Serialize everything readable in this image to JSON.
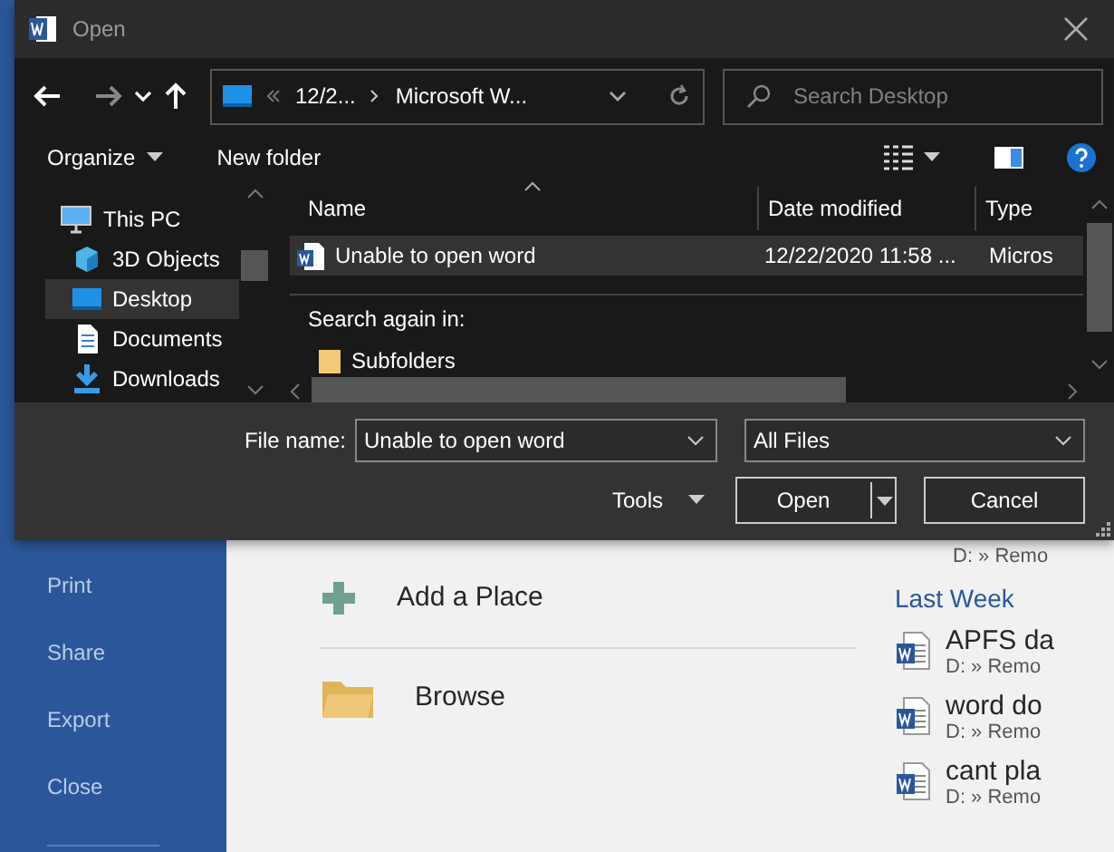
{
  "dialog": {
    "title": "Open",
    "address": {
      "segments": [
        "12/2...",
        "Microsoft W..."
      ]
    },
    "search": {
      "placeholder": "Search Desktop"
    },
    "toolbar": {
      "organize": "Organize",
      "new_folder": "New folder"
    },
    "nav_pane": [
      {
        "label": "This PC",
        "selected": false,
        "children": [
          {
            "label": "3D Objects",
            "selected": false,
            "kind": "cube"
          },
          {
            "label": "Desktop",
            "selected": true,
            "kind": "desktop"
          },
          {
            "label": "Documents",
            "selected": false,
            "kind": "document"
          },
          {
            "label": "Downloads",
            "selected": false,
            "kind": "download"
          }
        ]
      }
    ],
    "table": {
      "columns": [
        "Name",
        "Date modified",
        "Type"
      ],
      "rows": [
        {
          "name": "Unable to open word",
          "date": "12/22/2020 11:58 ...",
          "type": "Micros",
          "selected": true
        }
      ]
    },
    "search_again": {
      "label": "Search again in:",
      "items": [
        "Subfolders"
      ]
    },
    "file_name": {
      "label": "File name:",
      "value": "Unable to open word"
    },
    "file_type": {
      "value": "All Files"
    },
    "tools": "Tools",
    "buttons": [
      {
        "label": "Open",
        "kind": "split"
      },
      {
        "label": "Cancel",
        "kind": "plain"
      }
    ]
  },
  "backstage": {
    "menu": [
      "Print",
      "Share",
      "Export",
      "Close"
    ],
    "places": [
      {
        "label": "Add a Place",
        "kind": "add"
      },
      {
        "label": "Browse",
        "kind": "folder"
      }
    ],
    "recent": {
      "top_path": "D: » Remo",
      "group": "Last Week",
      "items": [
        {
          "title": "APFS da",
          "path": "D: » Remo"
        },
        {
          "title": "word do",
          "path": "D: » Remo"
        },
        {
          "title": "cant pla",
          "path": "D: » Remo"
        }
      ]
    }
  }
}
